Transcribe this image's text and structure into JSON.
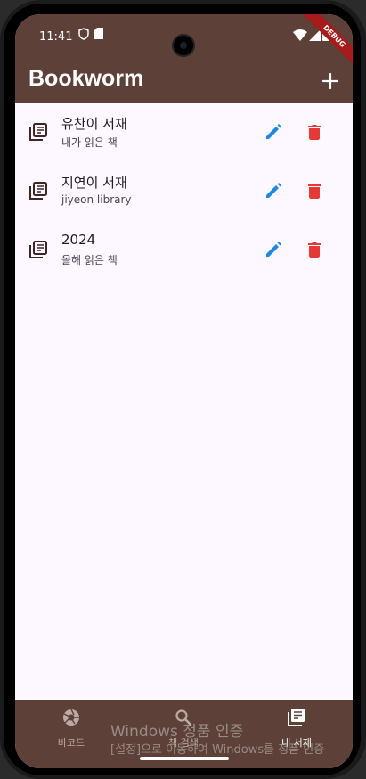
{
  "status_bar": {
    "time": "11:41",
    "debug_banner": "DEBUG"
  },
  "app_bar": {
    "title": "Bookworm",
    "add_icon": "plus-icon"
  },
  "colors": {
    "brand": "#5d4037",
    "edit": "#1e88e5",
    "delete": "#e53935",
    "background": "#fdf7ff"
  },
  "libraries": [
    {
      "title": "유찬이 서재",
      "subtitle": "내가 읽은 책"
    },
    {
      "title": "지연이 서재",
      "subtitle": "jiyeon library"
    },
    {
      "title": "2024",
      "subtitle": "올해 읽은 책"
    }
  ],
  "bottom_nav": {
    "items": [
      {
        "label": "바코드",
        "icon": "camera-aperture-icon",
        "selected": false
      },
      {
        "label": "책 검색",
        "icon": "search-icon",
        "selected": false
      },
      {
        "label": "내 서재",
        "icon": "library-icon",
        "selected": true
      }
    ]
  },
  "watermark": {
    "line1": "Windows 정품 인증",
    "line2": "[설정]으로 이동하여 Windows를 정품 인증"
  }
}
